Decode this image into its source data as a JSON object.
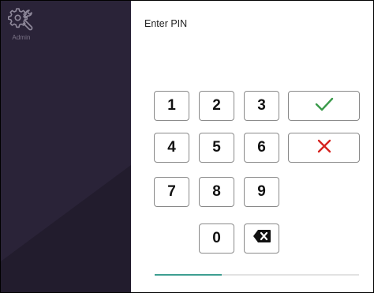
{
  "sidebar": {
    "admin_label": "Admin",
    "admin_icon": "gear-wrench-icon",
    "background": "#2a2338"
  },
  "pin": {
    "title": "Enter PIN",
    "keys": [
      "1",
      "2",
      "3",
      "4",
      "5",
      "6",
      "7",
      "8",
      "9",
      "0"
    ],
    "confirm_icon": "check-icon",
    "cancel_icon": "close-icon",
    "backspace_icon": "backspace-icon",
    "confirm_color": "#3a9a4a",
    "cancel_color": "#d6231f"
  },
  "progress": {
    "fraction": 0.33,
    "color": "#3e9e91"
  }
}
